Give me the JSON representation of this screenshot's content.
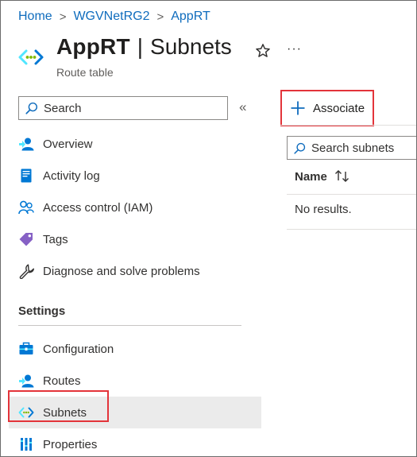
{
  "breadcrumb": {
    "items": [
      "Home",
      "WGVNetRG2",
      "AppRT"
    ],
    "separator": ">"
  },
  "header": {
    "title": "AppRT",
    "divider": "|",
    "section": "Subnets",
    "subtitle": "Route table",
    "favorite_icon": "star-icon",
    "more": "···"
  },
  "sidebar": {
    "search_placeholder": "Search",
    "collapse": "«",
    "items": [
      {
        "label": "Overview",
        "icon": "overview-icon"
      },
      {
        "label": "Activity log",
        "icon": "activity-log-icon"
      },
      {
        "label": "Access control (IAM)",
        "icon": "iam-icon"
      },
      {
        "label": "Tags",
        "icon": "tag-icon"
      },
      {
        "label": "Diagnose and solve problems",
        "icon": "wrench-icon"
      }
    ],
    "settings_label": "Settings",
    "settings_items": [
      {
        "label": "Configuration",
        "icon": "configuration-icon"
      },
      {
        "label": "Routes",
        "icon": "routes-icon"
      },
      {
        "label": "Subnets",
        "icon": "subnet-icon",
        "active": true
      },
      {
        "label": "Properties",
        "icon": "properties-icon"
      }
    ]
  },
  "main": {
    "associate_label": "Associate",
    "search_placeholder": "Search subnets",
    "column_name": "Name",
    "sort_glyph": "↑↓",
    "empty_text": "No results."
  },
  "colors": {
    "link": "#0f6cbd",
    "highlight": "#e3343a",
    "active_bg": "#ebebeb",
    "azure_blue": "#0078d4"
  }
}
